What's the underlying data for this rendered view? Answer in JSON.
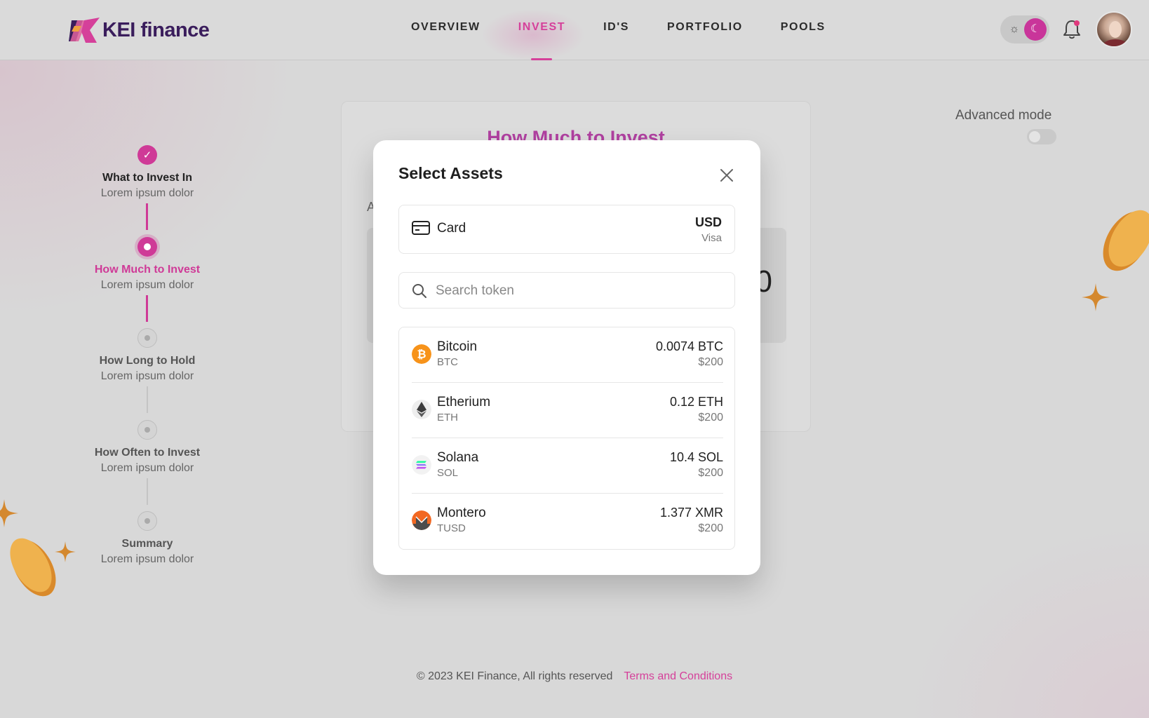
{
  "brand": {
    "name": "KEI finance"
  },
  "nav": {
    "items": [
      {
        "label": "OVERVIEW",
        "active": false
      },
      {
        "label": "INVEST",
        "active": true
      },
      {
        "label": "ID'S",
        "active": false
      },
      {
        "label": "PORTFOLIO",
        "active": false
      },
      {
        "label": "POOLS",
        "active": false
      }
    ]
  },
  "header": {
    "theme_mode": "dark",
    "has_notification": true
  },
  "stepper": {
    "steps": [
      {
        "title": "What to Invest In",
        "subtitle": "Lorem ipsum dolor",
        "state": "done"
      },
      {
        "title": "How Much to Invest",
        "subtitle": "Lorem ipsum dolor",
        "state": "active"
      },
      {
        "title": "How Long to Hold",
        "subtitle": "Lorem ipsum dolor",
        "state": "todo"
      },
      {
        "title": "How Often to Invest",
        "subtitle": "Lorem ipsum dolor",
        "state": "todo"
      },
      {
        "title": "Summary",
        "subtitle": "Lorem ipsum dolor",
        "state": "todo"
      }
    ]
  },
  "background_card": {
    "title": "How Much to Invest",
    "label_fragment": "A",
    "amount_fragment": "0"
  },
  "advanced_mode": {
    "label": "Advanced mode",
    "enabled": false
  },
  "modal": {
    "title": "Select Assets",
    "payment": {
      "label": "Card",
      "currency": "USD",
      "network": "Visa"
    },
    "search": {
      "placeholder": "Search token",
      "value": ""
    },
    "tokens": [
      {
        "name": "Bitcoin",
        "symbol": "BTC",
        "amount": "0.0074 BTC",
        "usd": "$200",
        "icon": "bitcoin-icon",
        "color": "#f7931a"
      },
      {
        "name": "Etherium",
        "symbol": "ETH",
        "amount": "0.12 ETH",
        "usd": "$200",
        "icon": "ethereum-icon",
        "color": "#3c3c3d"
      },
      {
        "name": "Solana",
        "symbol": "SOL",
        "amount": "10.4 SOL",
        "usd": "$200",
        "icon": "solana-icon",
        "color": "#9945ff"
      },
      {
        "name": "Montero",
        "symbol": "TUSD",
        "amount": "1.377 XMR",
        "usd": "$200",
        "icon": "monero-icon",
        "color": "#f26822"
      }
    ]
  },
  "footer": {
    "copyright": "© 2023 KEI Finance, All rights reserved",
    "terms": "Terms and Conditions"
  },
  "colors": {
    "accent": "#d5409a",
    "brand_dark": "#3a1d5c",
    "coin": "#e8a33d"
  }
}
